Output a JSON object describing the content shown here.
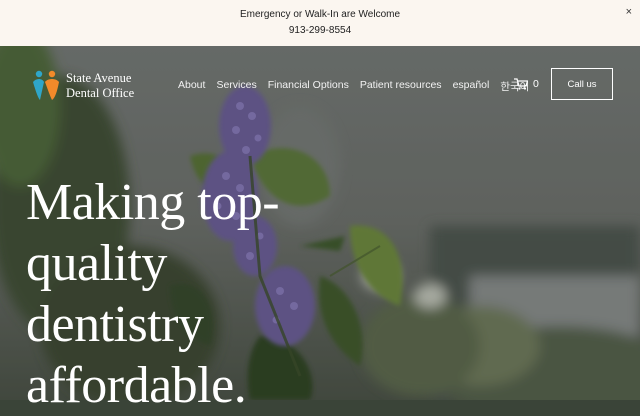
{
  "announcement": {
    "line1": "Emergency or Walk-In are Welcome",
    "line2": "913-299-8554",
    "close_symbol": "×"
  },
  "logo": {
    "line1": "State Avenue",
    "line2": "Dental Office",
    "colors": {
      "teal": "#2fa6c9",
      "orange": "#f28a2a"
    }
  },
  "nav": {
    "items": [
      "About",
      "Services",
      "Financial Options",
      "Patient resources",
      "español",
      "한국어"
    ]
  },
  "cart": {
    "count": "0",
    "icon": "cart-icon"
  },
  "cta": {
    "label": "Call us"
  },
  "hero": {
    "headline_lines": [
      "Making top-",
      "quality",
      "dentistry",
      "affordable."
    ]
  }
}
